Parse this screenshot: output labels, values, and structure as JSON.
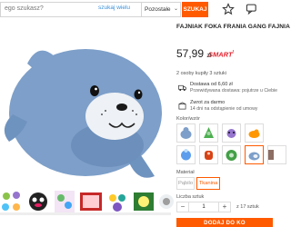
{
  "search": {
    "placeholder": "ego szukasz?",
    "scope_label": "szukaj wielu",
    "category": "Pozostałe",
    "button_label": "SZUKAJ"
  },
  "header_icons": [
    "star-icon",
    "chat-icon"
  ],
  "product": {
    "title": "FAJNIAK FOKA FRANIA GANG FAJNIA",
    "price": "57,99",
    "currency": "zł",
    "smart_label": "SMART",
    "smart_sup": "!",
    "sold": "2 osoby kupiły 3 sztuki"
  },
  "delivery": {
    "line1": "Dostawa od 6,60 zł",
    "line2": "Przewidywana dostawa: pojutrze u Ciebie"
  },
  "returns": {
    "line1": "Zwrot za darmo",
    "line2": "14 dni na odstąpienie od umowy"
  },
  "variants_label": "Kolor/wzór",
  "variant_icons": [
    "variant-1",
    "variant-2",
    "variant-3",
    "variant-4",
    "variant-5",
    "variant-6",
    "variant-7",
    "variant-8",
    "variant-9",
    "variant-10"
  ],
  "material": {
    "label": "Materiał",
    "options": [
      "Pąbilo",
      "Tkanina"
    ],
    "selected": "Tkanina"
  },
  "quantity": {
    "label": "Liczba sztuk",
    "value": "1",
    "of_text": "z 17 sztuk"
  },
  "add_to_cart": "DODAJ DO KO",
  "colors": {
    "accent": "#ff5a00",
    "seal": "#7d9fc9"
  }
}
